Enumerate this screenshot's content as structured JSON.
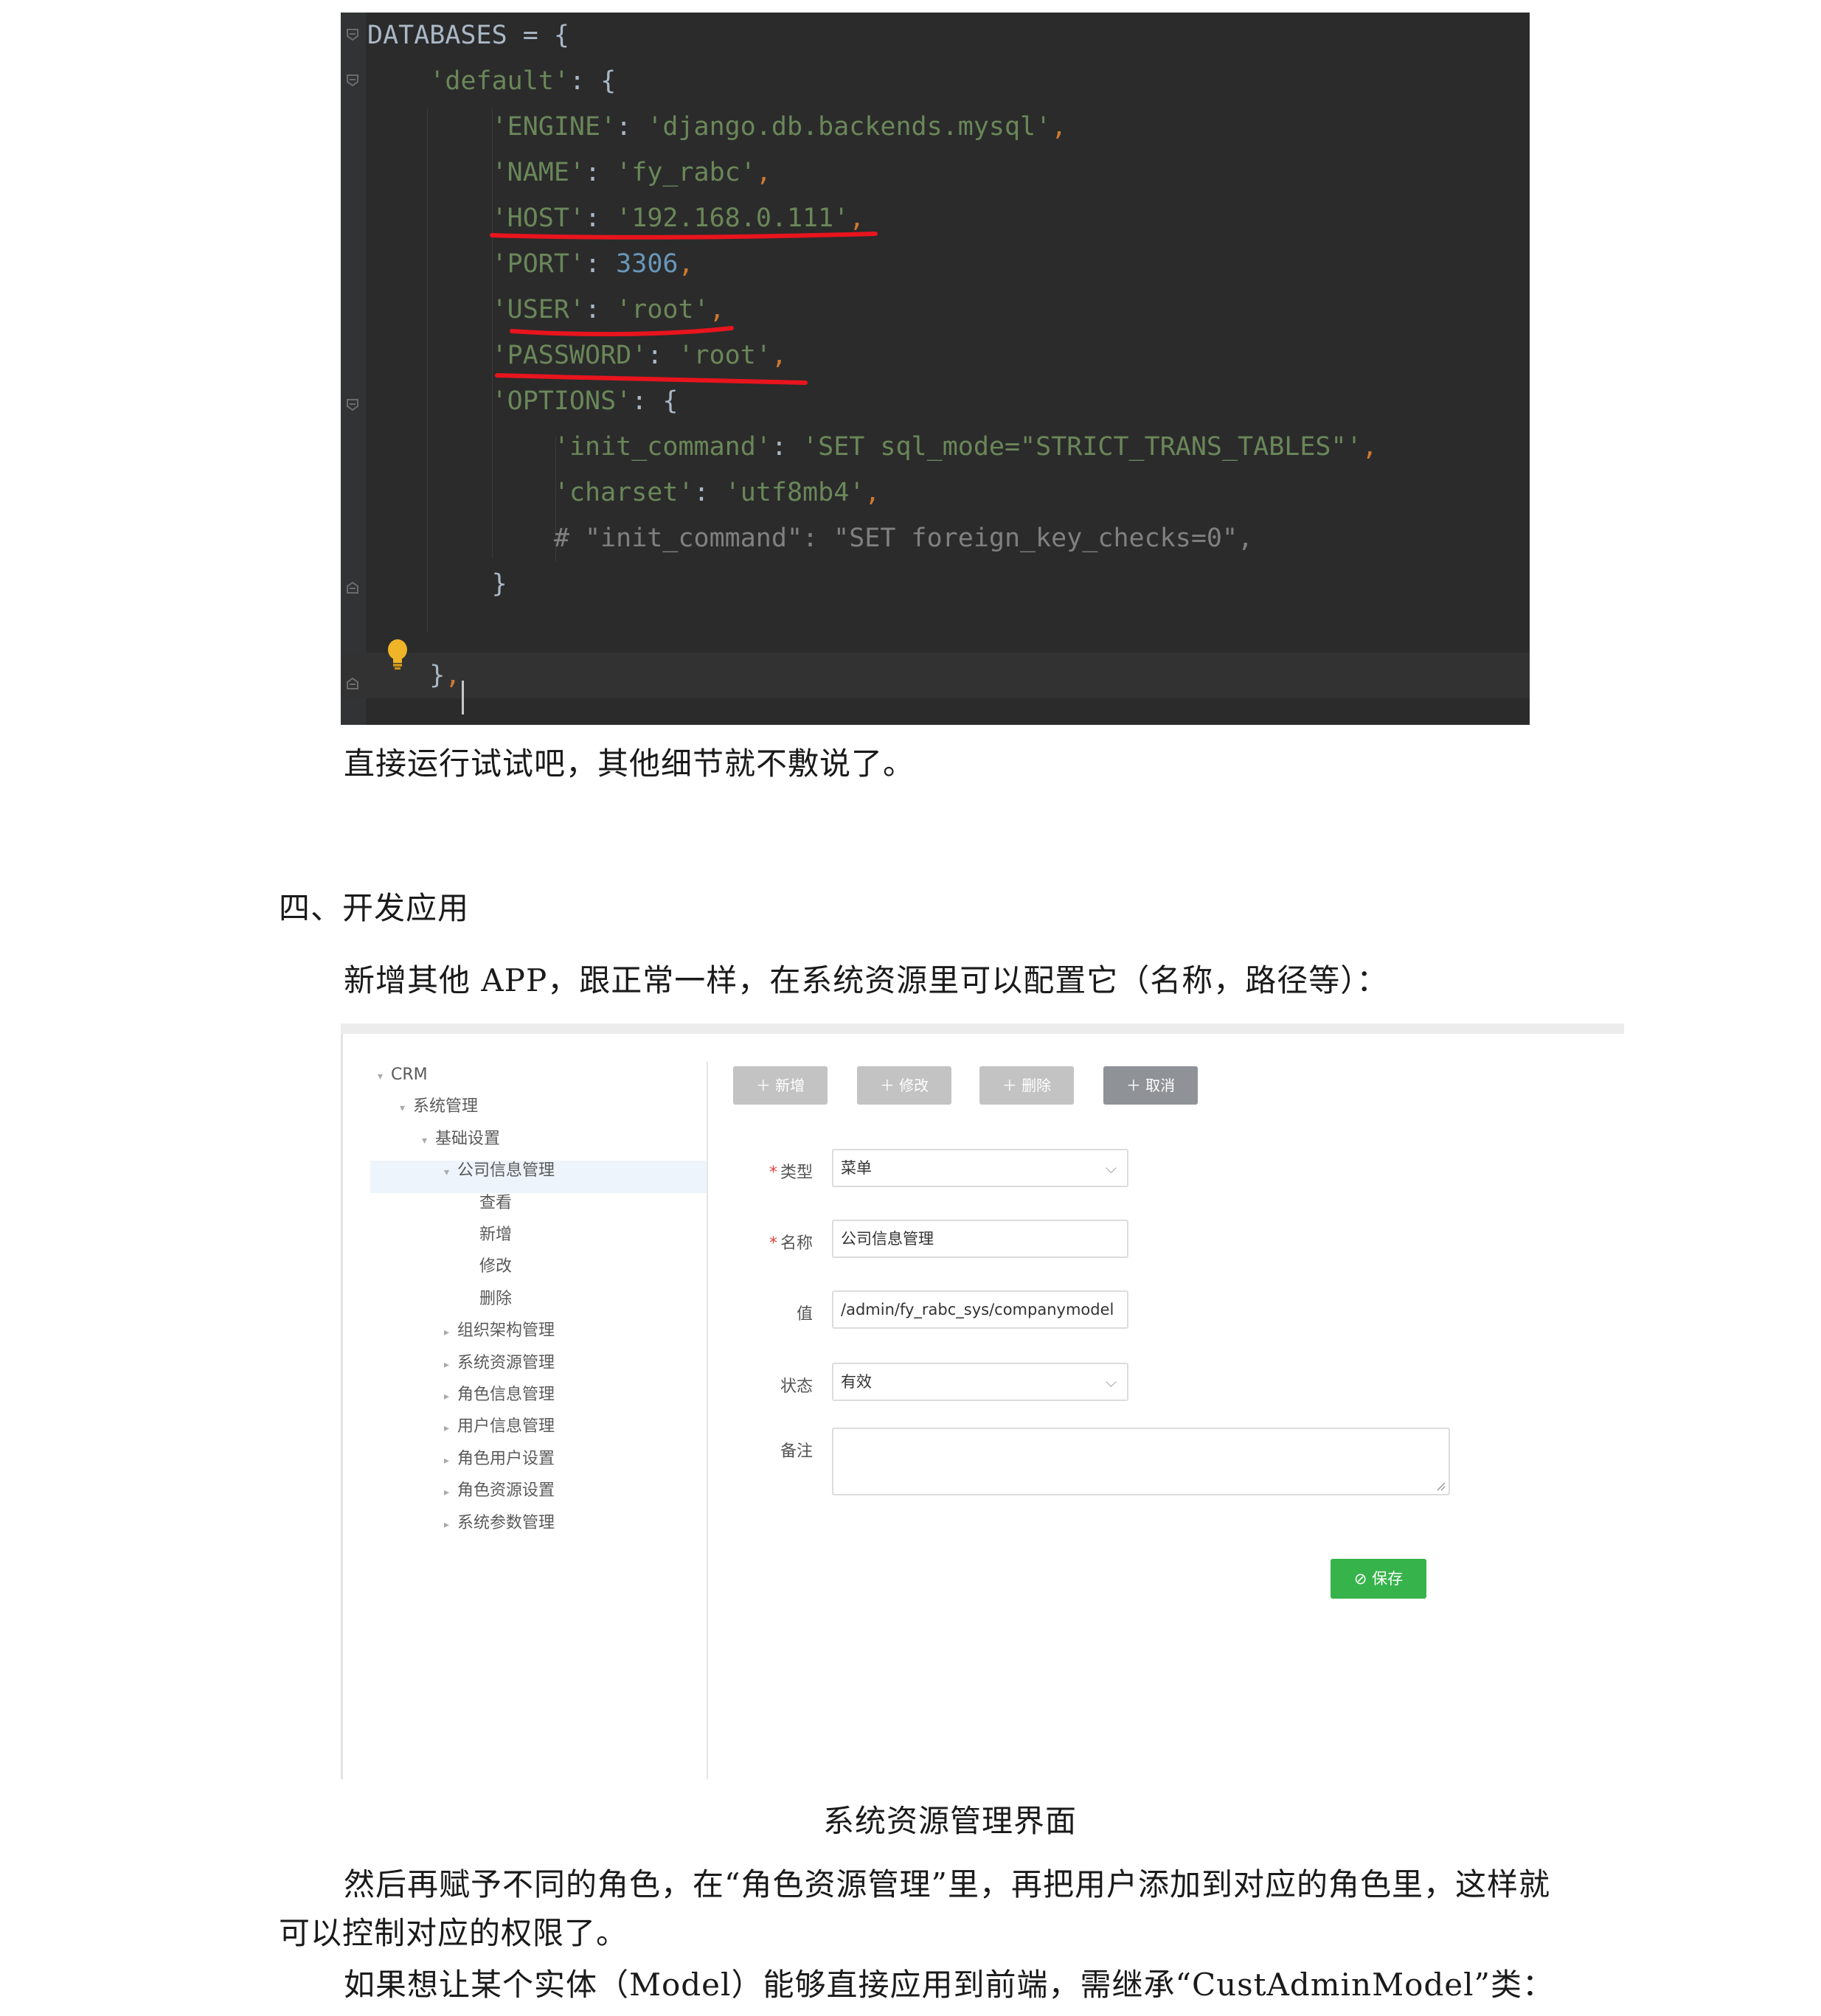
{
  "code": {
    "lines": [
      {
        "parts": [
          [
            "",
            "DATABASES = {"
          ]
        ]
      },
      {
        "parts": [
          [
            "",
            "    "
          ],
          [
            "s",
            "'default'"
          ],
          [
            "",
            ": {"
          ]
        ]
      },
      {
        "parts": [
          [
            "",
            "        "
          ],
          [
            "s",
            "'ENGINE'"
          ],
          [
            "",
            ": "
          ],
          [
            "s",
            "'django.db.backends.mysql'"
          ],
          [
            "p",
            ","
          ]
        ]
      },
      {
        "parts": [
          [
            "",
            "        "
          ],
          [
            "s",
            "'NAME'"
          ],
          [
            "",
            ": "
          ],
          [
            "s",
            "'fy_rabc'"
          ],
          [
            "p",
            ","
          ]
        ]
      },
      {
        "parts": [
          [
            "",
            "        "
          ],
          [
            "s",
            "'HOST'"
          ],
          [
            "",
            ": "
          ],
          [
            "s",
            "'192.168.0.111'"
          ],
          [
            "p",
            ","
          ]
        ]
      },
      {
        "parts": [
          [
            "",
            "        "
          ],
          [
            "s",
            "'PORT'"
          ],
          [
            "",
            ": "
          ],
          [
            "n",
            "3306"
          ],
          [
            "p",
            ","
          ]
        ]
      },
      {
        "parts": [
          [
            "",
            "        "
          ],
          [
            "s",
            "'USER'"
          ],
          [
            "",
            ": "
          ],
          [
            "s",
            "'root'"
          ],
          [
            "p",
            ","
          ]
        ]
      },
      {
        "parts": [
          [
            "",
            "        "
          ],
          [
            "s",
            "'PASSWORD'"
          ],
          [
            "",
            ": "
          ],
          [
            "s",
            "'root'"
          ],
          [
            "p",
            ","
          ]
        ]
      },
      {
        "parts": [
          [
            "",
            "        "
          ],
          [
            "s",
            "'OPTIONS'"
          ],
          [
            "",
            ": {"
          ]
        ]
      },
      {
        "parts": [
          [
            "",
            "            "
          ],
          [
            "s",
            "'init_command'"
          ],
          [
            "",
            ": "
          ],
          [
            "s",
            "'SET sql_mode=\"STRICT_TRANS_TABLES\"'"
          ],
          [
            "p",
            ","
          ]
        ]
      },
      {
        "parts": [
          [
            "",
            "            "
          ],
          [
            "s",
            "'charset'"
          ],
          [
            "",
            ": "
          ],
          [
            "s",
            "'utf8mb4'"
          ],
          [
            "p",
            ","
          ]
        ]
      },
      {
        "parts": [
          [
            "",
            "            "
          ],
          [
            "c",
            "# \"init_command\": \"SET foreign_key_checks=0\","
          ]
        ]
      },
      {
        "parts": [
          [
            "",
            "        }"
          ]
        ]
      },
      {
        "parts": [
          [
            "",
            ""
          ]
        ]
      },
      {
        "parts": [
          [
            "",
            "    }"
          ],
          [
            "p",
            ","
          ]
        ]
      }
    ]
  },
  "text": {
    "p1": "直接运行试试吧，其他细节就不敷说了。",
    "heading": "四、开发应用",
    "p2": "新增其他 APP，跟正常一样，在系统资源里可以配置它（名称，路径等）：",
    "caption": "系统资源管理界面",
    "p3a": "然后再赋予不同的角色，在“角色资源管理”里，再把用户添加到对应的角色里，这样就",
    "p3b": "可以控制对应的权限了。",
    "p4": "如果想让某个实体（Model）能够直接应用到前端，需继承“CustAdminModel”类："
  },
  "screenshot": {
    "tree": [
      {
        "label": "CRM",
        "arrow": "▾"
      },
      {
        "label": "系统管理",
        "arrow": "▾"
      },
      {
        "label": "基础设置",
        "arrow": "▾"
      },
      {
        "label": "公司信息管理",
        "arrow": "▾"
      },
      {
        "label": "查看",
        "arrow": ""
      },
      {
        "label": "新增",
        "arrow": ""
      },
      {
        "label": "修改",
        "arrow": ""
      },
      {
        "label": "删除",
        "arrow": ""
      },
      {
        "label": "组织架构管理",
        "arrow": "▸"
      },
      {
        "label": "系统资源管理",
        "arrow": "▸"
      },
      {
        "label": "角色信息管理",
        "arrow": "▸"
      },
      {
        "label": "用户信息管理",
        "arrow": "▸"
      },
      {
        "label": "角色用户设置",
        "arrow": "▸"
      },
      {
        "label": "角色资源设置",
        "arrow": "▸"
      },
      {
        "label": "系统参数管理",
        "arrow": "▸"
      }
    ],
    "toolbar": {
      "add": "＋ 新增",
      "edit": "＋ 修改",
      "delete": "＋ 删除",
      "cancel": "＋ 取消"
    },
    "form": {
      "type_label": "类型",
      "type_value": "菜单",
      "name_label": "名称",
      "name_value": "公司信息管理",
      "value_label": "值",
      "value_value": "/admin/fy_rabc_sys/companymodel",
      "status_label": "状态",
      "status_value": "有效",
      "remark_label": "备注",
      "required_mark": "*",
      "chevron": "⌵",
      "save": "⊘ 保存"
    }
  },
  "colors": {
    "editor_bg": "#2b2b2b",
    "string": "#6a8759",
    "number": "#6897bb",
    "punct": "#cc7832",
    "comment": "#808080",
    "underline": "#e8141e",
    "save_button": "#36b34a"
  }
}
